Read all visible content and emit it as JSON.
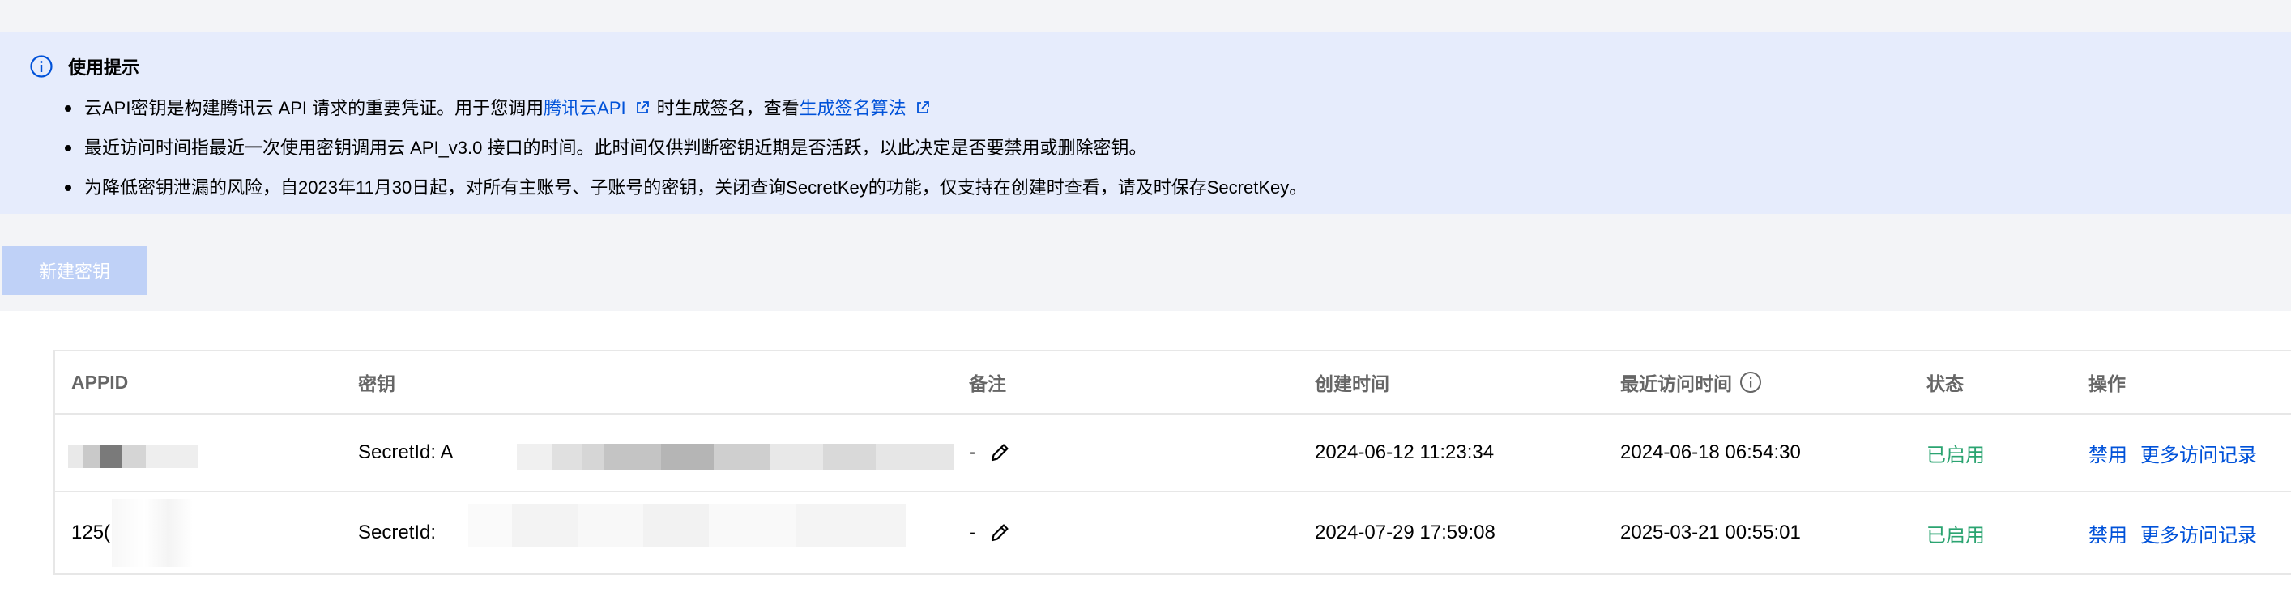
{
  "tips": {
    "title": "使用提示",
    "items": [
      {
        "p1": "云API密钥是构建腾讯云 API 请求的重要凭证。用于您调用",
        "link1": "腾讯云API",
        "p2": "时生成签名，查看",
        "link2": "生成签名算法"
      },
      {
        "text": "最近访问时间指最近一次使用密钥调用云 API_v3.0 接口的时间。此时间仅供判断密钥近期是否活跃，以此决定是否要禁用或删除密钥。"
      },
      {
        "text": "为降低密钥泄漏的风险，自2023年11月30日起，对所有主账号、子账号的密钥，关闭查询SecretKey的功能，仅支持在创建时查看，请及时保存SecretKey。"
      }
    ]
  },
  "toolbar": {
    "create_label": "新建密钥"
  },
  "table": {
    "headers": {
      "appid": "APPID",
      "key": "密钥",
      "note": "备注",
      "created": "创建时间",
      "last_visit": "最近访问时间",
      "status": "状态",
      "ops": "操作"
    },
    "rows": [
      {
        "appid": "",
        "key": "SecretId: A",
        "note": "-",
        "created": "2024-06-12 11:23:34",
        "last_visit": "2024-06-18 06:54:30",
        "status": "已启用",
        "op_disable": "禁用",
        "op_more": "更多访问记录"
      },
      {
        "appid": "125(",
        "key": "SecretId:",
        "note": "-",
        "created": "2024-07-29 17:59:08",
        "last_visit": "2025-03-21 00:55:01",
        "status": "已启用",
        "op_disable": "禁用",
        "op_more": "更多访问记录"
      }
    ]
  },
  "colors": {
    "accent": "#0052d9",
    "success": "#2ba471",
    "tip_bg": "#e6ecfc",
    "disabled_btn": "#bfd1f7"
  },
  "icons": [
    "info-icon",
    "external-link-icon",
    "edit-icon",
    "question-info-icon"
  ]
}
